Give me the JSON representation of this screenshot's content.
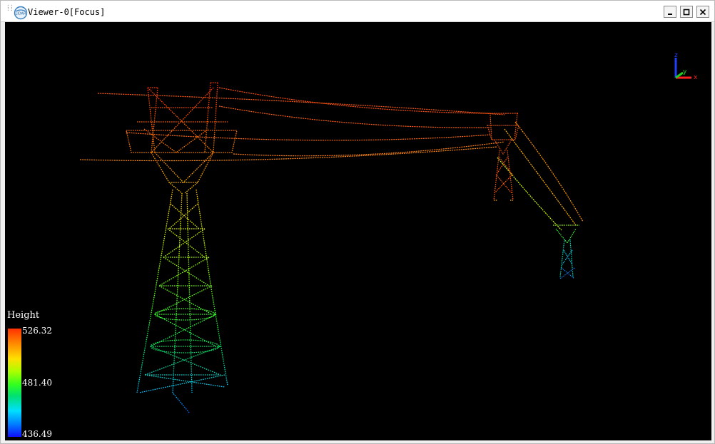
{
  "window": {
    "title": "Viewer-0[Focus]",
    "icon": "lidar-app-icon",
    "buttons": [
      "minimize-icon",
      "maximize-icon",
      "close-icon"
    ]
  },
  "legend": {
    "title": "Height",
    "max": "526.32",
    "mid": "481.40",
    "min": "436.49",
    "colormap": [
      "#ff3000",
      "#ffe000",
      "#30ff20",
      "#00e0ff",
      "#1010ff"
    ]
  },
  "axes": {
    "z": "z",
    "y": "y",
    "x": "x",
    "colors": {
      "x": "#ff2020",
      "y": "#20d020",
      "z": "#2040ff"
    }
  },
  "colors": {
    "viewport_bg": "#000000",
    "chrome_bg": "#f0f0f0"
  }
}
